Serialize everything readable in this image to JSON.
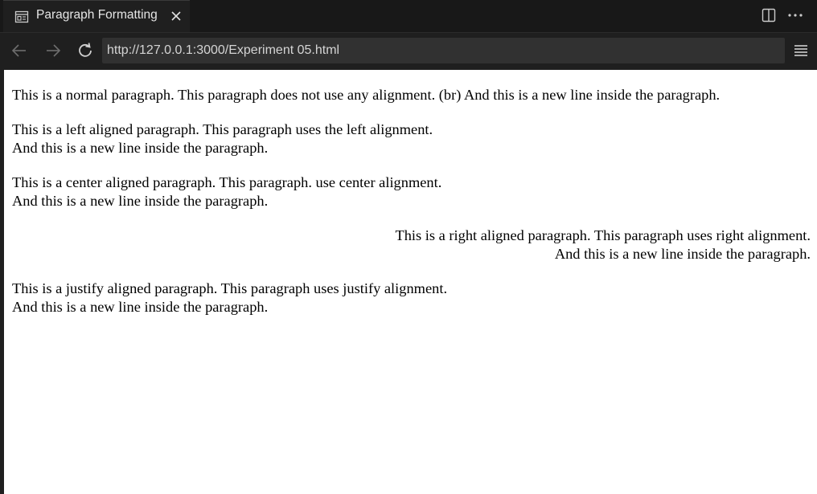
{
  "tab": {
    "title": "Paragraph Formatting"
  },
  "icons": {
    "tab": "preview-icon",
    "close": "close-icon",
    "split": "split-editor-icon",
    "more": "more-actions-icon",
    "back": "arrow-left-icon",
    "forward": "arrow-right-icon",
    "reload": "reload-icon",
    "menu": "menu-icon"
  },
  "nav": {
    "url": "http://127.0.0.1:3000/Experiment 05.html"
  },
  "page": {
    "normal": "This is a normal paragraph. This paragraph does not use any alignment. (br) And this is a new line inside the paragraph.",
    "left": {
      "line1": "This is a left aligned paragraph. This paragraph uses the left alignment.",
      "line2": "And this is a new line inside the paragraph."
    },
    "center": {
      "line1": "This is a center aligned paragraph. This paragraph. use center alignment.",
      "line2": "And this is a new line inside the paragraph."
    },
    "right": {
      "line1": "This is a right aligned paragraph. This paragraph uses right alignment.",
      "line2": "And this is a new line inside the paragraph."
    },
    "justify": {
      "line1": "This is a justify aligned paragraph. This paragraph uses justify alignment.",
      "line2": "And this is a new line inside the paragraph."
    }
  },
  "colors": {
    "chrome_bg": "#1f1f1f",
    "tabbar_bg": "#181818",
    "url_bg": "#313131",
    "page_bg": "#ffffff"
  }
}
